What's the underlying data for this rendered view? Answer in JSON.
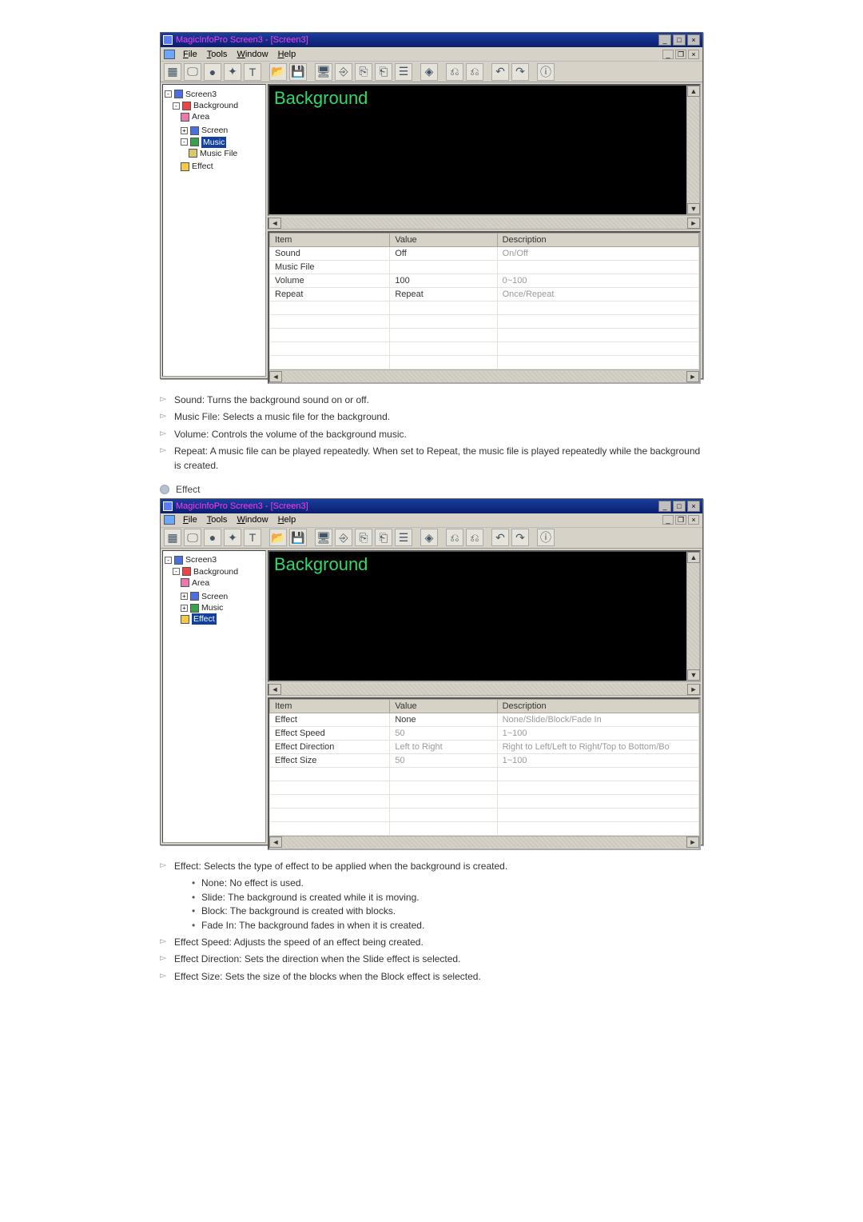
{
  "app": {
    "title": "MagicInfoPro Screen3 - [Screen3]",
    "window_controls": {
      "min": "_",
      "max": "□",
      "close": "×"
    },
    "menu": {
      "file": "File",
      "tools": "Tools",
      "window": "Window",
      "help": "Help"
    },
    "mdi_controls": {
      "min": "_",
      "restore": "❐",
      "close": "×"
    },
    "toolbar_icons": [
      "new-icon",
      "monitor-icon",
      "stop-icon",
      "wand-icon",
      "text-icon",
      "folder-icon",
      "save-icon",
      "display-icon",
      "layer-front-icon",
      "layer-mid-icon",
      "layer-back-icon",
      "list-icon",
      "gem-icon",
      "bring-front-icon",
      "send-back-icon",
      "undo-icon",
      "redo-icon",
      "info-icon"
    ],
    "toolbar_glyphs": [
      "▦",
      "🖵",
      "●",
      "✦",
      "T",
      "📂",
      "💾",
      "🖥",
      "⎆",
      "⎘",
      "⎗",
      "☰",
      "◈",
      "⎌",
      "⎌",
      "↶",
      "↷",
      "ⓘ"
    ]
  },
  "tree_music": {
    "root": "Screen3",
    "background": "Background",
    "area": "Area",
    "screen": "Screen",
    "music": "Music",
    "music_file": "Music File",
    "effect": "Effect"
  },
  "tree_effect": {
    "root": "Screen3",
    "background": "Background",
    "area": "Area",
    "screen": "Screen",
    "music": "Music",
    "effect": "Effect"
  },
  "canvas": {
    "title": "Background"
  },
  "scroll": {
    "left": "◄",
    "right": "►",
    "up": "▲",
    "down": "▼"
  },
  "grid_headers": {
    "item": "Item",
    "value": "Value",
    "description": "Description"
  },
  "grid_music": {
    "rows": [
      {
        "item": "Sound",
        "value": "Off",
        "desc": "On/Off"
      },
      {
        "item": "Music File",
        "value": "",
        "desc": ""
      },
      {
        "item": "Volume",
        "value": "100",
        "desc": "0~100"
      },
      {
        "item": "Repeat",
        "value": "Repeat",
        "desc": "Once/Repeat"
      }
    ]
  },
  "grid_effect": {
    "rows": [
      {
        "item": "Effect",
        "value": "None",
        "desc": "None/Slide/Block/Fade In"
      },
      {
        "item": "Effect Speed",
        "value": "50",
        "desc": "1~100",
        "dim": true
      },
      {
        "item": "Effect Direction",
        "value": "Left to Right",
        "desc": "Right to Left/Left to Right/Top to Bottom/Bo",
        "dim": true
      },
      {
        "item": "Effect Size",
        "value": "50",
        "desc": "1~100",
        "dim": true
      }
    ]
  },
  "doc": {
    "music_bullets": [
      "Sound: Turns the background sound on or off.",
      "Music File: Selects a music file for the background.",
      "Volume: Controls the volume of the background music.",
      "Repeat: A music file can be played repeatedly. When set to Repeat, the music file is played repeatedly while the background is created."
    ],
    "effect_label": "Effect",
    "effect_main_bullet": "Effect: Selects the type of effect to be applied when the background is created.",
    "effect_sub_bullets": [
      "None: No effect is used.",
      "Slide: The background is created while it is moving.",
      "Block: The background is created with blocks.",
      "Fade In: The background fades in when it is created."
    ],
    "effect_tail_bullets": [
      "Effect Speed: Adjusts the speed of an effect being created.",
      "Effect Direction: Sets the direction when the Slide effect is selected.",
      "Effect Size: Sets the size of the blocks when the Block effect is selected."
    ]
  }
}
